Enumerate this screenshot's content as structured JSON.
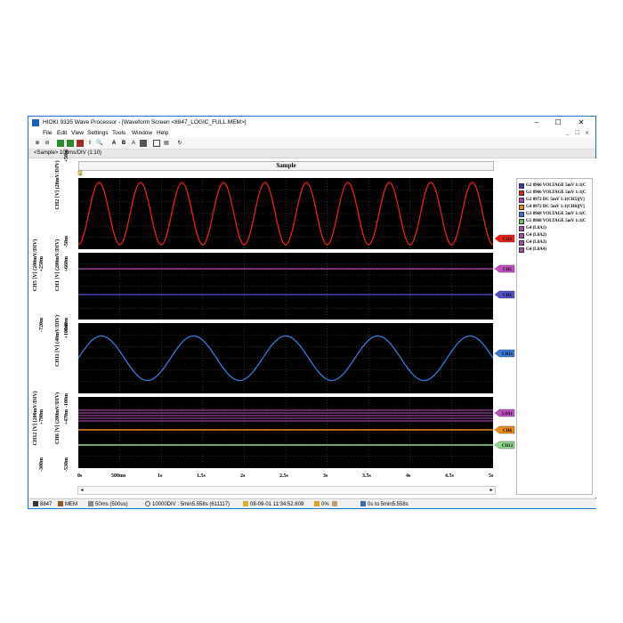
{
  "window": {
    "title": "HIOKI 9335 Wave Processor - [Waveform Screen <8847_LOGIC_FULL.MEM>]",
    "controls": [
      "–",
      "☐",
      "✕"
    ],
    "mdi_controls": [
      "_",
      "☐",
      "✕"
    ]
  },
  "menu": [
    "File",
    "Edit",
    "View",
    "Settings",
    "Tools",
    "Window",
    "Help"
  ],
  "toolbar_icons": [
    "zoom-in-icon",
    "zoom-out-icon",
    "cursor-a-icon",
    "cursor-b-icon",
    "cursor-ab-icon",
    "cursor-move-icon",
    "search-icon",
    "label-a-icon",
    "label-b-icon",
    "label-text-icon",
    "channel-icon",
    "screen-icon",
    "print-icon",
    "refresh-icon"
  ],
  "mode_bar": "<Sample> 100ms/DIV (1:10)",
  "sample_header": "Sample",
  "marker_label": "1",
  "panes": [
    {
      "name": "CH2 [V] (20mV/DIV)",
      "top": "+50m",
      "bottom": "-50m",
      "bottom2": ""
    },
    {
      "name": "CH5 [V] (200mV/DIV)",
      "name2": "CH1 [V] (200mV/DIV)",
      "top": "+250m",
      "top2": "+660m",
      "bottom": "-720m",
      "bottom2": "-340m"
    },
    {
      "name": "CH11 [V] (40mV/DIV)",
      "top": "+100m",
      "bottom": "-100m"
    },
    {
      "name": "CH12 [V] (200mV/DIV)",
      "name2": "CH6 [V] (200mV/DIV)",
      "top": "+790m",
      "top2": "+470m",
      "bottom": "-300m",
      "bottom2": "-530m"
    }
  ],
  "channel_tags": {
    "CH2": "CH2",
    "CH5": "CH5",
    "CH1": "CH1",
    "CH11": "CH11",
    "L8A1": "L8A1",
    "CH6": "CH6",
    "CH12": "CH12"
  },
  "x_ticks": [
    "0s",
    "500ms",
    "1s",
    "1.5s",
    "2s",
    "2.5s",
    "3s",
    "3.5s",
    "4s",
    "4.5s",
    "5s"
  ],
  "legend": [
    {
      "label": "G2 8966 VOLTAGE 5mV 1:1(C",
      "color": "#3a3ab0"
    },
    {
      "label": "G1 8966 VOLTAGE 5mV 1:1(C",
      "color": "#d42020"
    },
    {
      "label": "G2 8972 DC 5mV 1:1(CH5)[V]",
      "color": "#b044b0"
    },
    {
      "label": "G4 8972 DC 5mV 1:1(CH6)[V]",
      "color": "#e88a10"
    },
    {
      "label": "G3 8968 VOLTAGE 5mV 1:1(C",
      "color": "#3a70d0"
    },
    {
      "label": "G5 8968 VOLTAGE 5mV 1:1(C",
      "color": "#70c070"
    },
    {
      "label": "G4 (L8A1)",
      "color": "#a050a0"
    },
    {
      "label": "G4 (L8A2)",
      "color": "#a050a0"
    },
    {
      "label": "G4 (L8A3)",
      "color": "#a050a0"
    },
    {
      "label": "G4 (L8A4)",
      "color": "#a050a0"
    }
  ],
  "status": {
    "model": "8847",
    "source": "MEM",
    "sampling": "50ms (500us)",
    "length": "10000DIV : 5min5.558s (611117)",
    "datetime": "08-09-01 11:34:52.609",
    "percent": "0%",
    "range": "0s to 5min5.558s"
  },
  "colors": {
    "ch2": "#e8201a",
    "ch5": "#c050c0",
    "ch1": "#5050c8",
    "ch11": "#3a7ad8",
    "ch6": "#f08c10",
    "ch12": "#90d890",
    "logic": "#c050c0",
    "grid": "#5a5a5a"
  }
}
